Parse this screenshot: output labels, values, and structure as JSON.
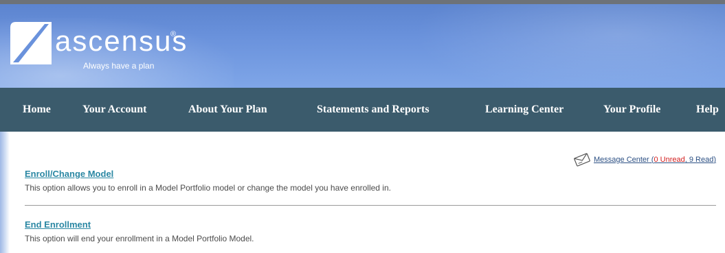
{
  "brand": {
    "name": "ascensus",
    "registered_mark": "®",
    "tagline": "Always have a plan",
    "header_color": "#6a92dc",
    "nav_color": "#3b5b6c"
  },
  "nav": {
    "items": [
      {
        "label": "Home"
      },
      {
        "label": "Your Account"
      },
      {
        "label": "About Your Plan"
      },
      {
        "label": "Statements and Reports"
      },
      {
        "label": "Learning Center"
      },
      {
        "label": "Your Profile"
      },
      {
        "label": "Help"
      }
    ]
  },
  "message_center": {
    "icon": "message-icon",
    "label": "Message Center",
    "open_paren": " (",
    "unread_count": "0",
    "unread_label": " Unread",
    "separator": ", ",
    "read_count": "9",
    "read_label": " Read",
    "close_paren": ")",
    "unread_color": "#d11b1b"
  },
  "options": [
    {
      "title": "Enroll/Change Model",
      "description": "This option allows you to enroll in a Model Portfolio model or change the model you have enrolled in."
    },
    {
      "title": "End Enrollment",
      "description": "This option will end your enrollment in a Model Portfolio Model."
    }
  ],
  "link_color": "#2a87a3"
}
